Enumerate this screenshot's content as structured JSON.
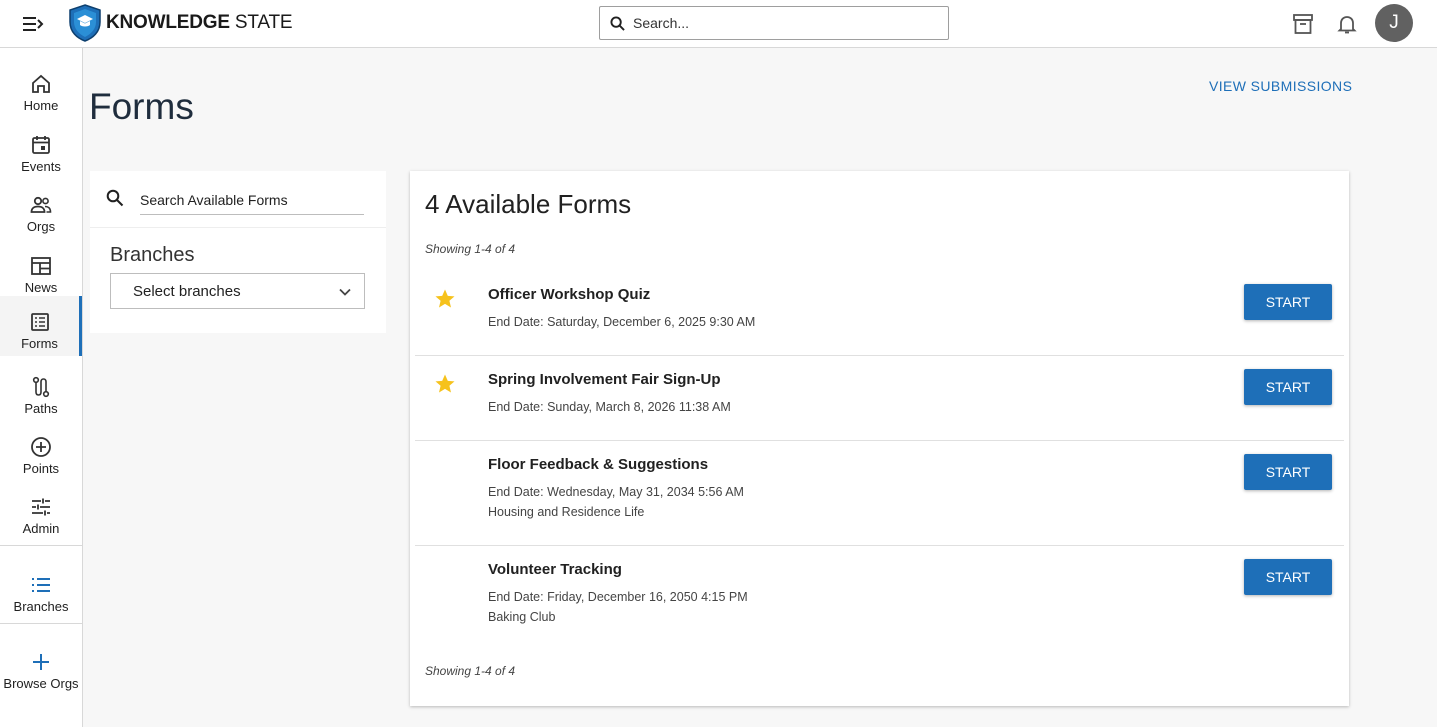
{
  "header": {
    "logo_bold": "KNOWLEDGE",
    "logo_rest": "STATE",
    "search_placeholder": "Search...",
    "avatar_initial": "J"
  },
  "sidebar": {
    "items": [
      {
        "label": "Home",
        "icon": "home-icon"
      },
      {
        "label": "Events",
        "icon": "calendar-icon"
      },
      {
        "label": "Orgs",
        "icon": "people-icon"
      },
      {
        "label": "News",
        "icon": "news-icon"
      },
      {
        "label": "Forms",
        "icon": "forms-icon"
      },
      {
        "label": "Paths",
        "icon": "paths-icon"
      },
      {
        "label": "Points",
        "icon": "plus-circle-icon"
      },
      {
        "label": "Admin",
        "icon": "sliders-icon"
      }
    ],
    "branches_label": "Branches",
    "browse_orgs_label": "Browse Orgs",
    "active": "Forms"
  },
  "page": {
    "title": "Forms",
    "view_submissions": "VIEW SUBMISSIONS"
  },
  "filters": {
    "search_placeholder": "Search Available Forms",
    "branches_title": "Branches",
    "branches_select": "Select branches"
  },
  "forms": {
    "title": "4 Available Forms",
    "showing": "Showing 1-4 of 4",
    "start_label": "START",
    "items": [
      {
        "name": "Officer Workshop Quiz",
        "end_date": "End Date: Saturday, December 6, 2025 9:30 AM",
        "branch": "",
        "starred": true
      },
      {
        "name": "Spring Involvement Fair Sign-Up",
        "end_date": "End Date: Sunday, March 8, 2026 11:38 AM",
        "branch": "",
        "starred": true
      },
      {
        "name": "Floor Feedback & Suggestions",
        "end_date": "End Date: Wednesday, May 31, 2034 5:56 AM",
        "branch": "Housing and Residence Life",
        "starred": false
      },
      {
        "name": "Volunteer Tracking",
        "end_date": "End Date: Friday, December 16, 2050 4:15 PM",
        "branch": "Baking Club",
        "starred": false
      }
    ]
  },
  "colors": {
    "accent": "#1e6fb8",
    "star": "#f6c21c",
    "shield": "#1e6fb8"
  }
}
